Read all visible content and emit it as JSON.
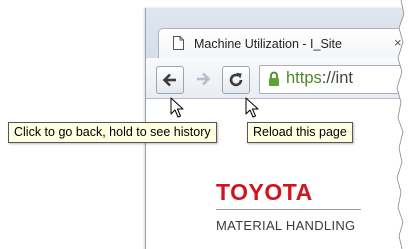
{
  "browser": {
    "tab": {
      "title": "Machine Utilization - I_Site",
      "close_glyph": "×",
      "page_icon": "document-icon"
    },
    "toolbar": {
      "back_icon": "back-arrow-icon",
      "forward_icon": "forward-arrow-icon",
      "reload_icon": "reload-icon"
    },
    "omnibox": {
      "lock_icon": "lock-icon",
      "scheme": "https",
      "separator": "://",
      "host_visible": "int"
    }
  },
  "tooltips": {
    "back": "Click to go back, hold to see history",
    "reload": "Reload this page"
  },
  "page": {
    "logo_brand": "TOYOTA",
    "logo_subtitle": "MATERIAL HANDLING"
  },
  "colors": {
    "brand_red": "#d2141f",
    "secure_green": "#4a8a2a",
    "tooltip_bg": "#ffffe1"
  }
}
